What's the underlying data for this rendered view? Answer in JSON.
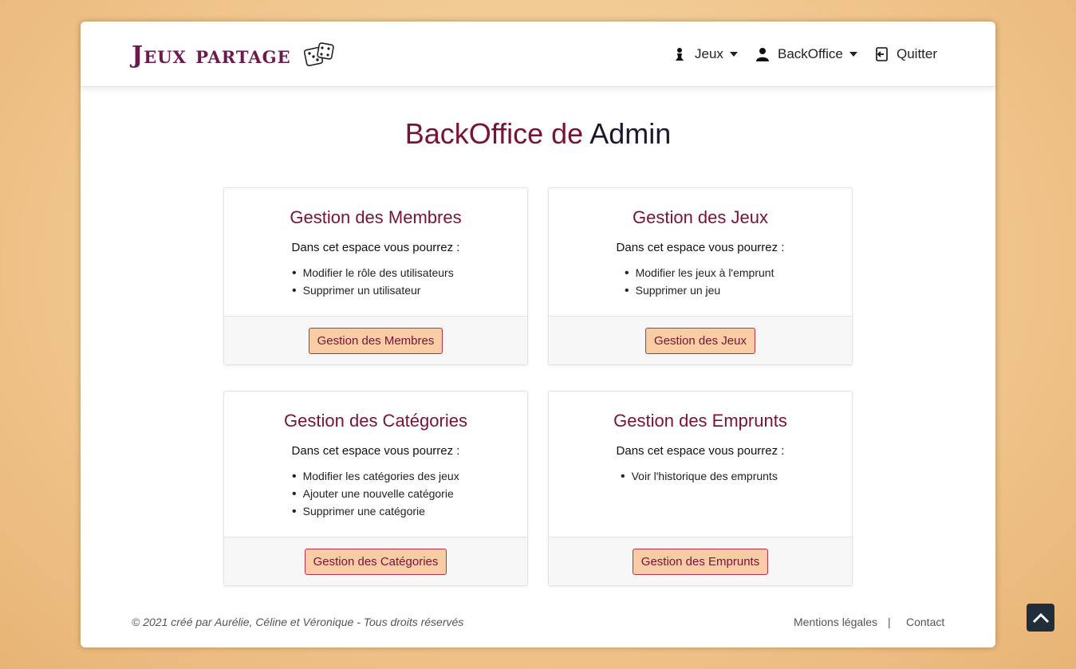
{
  "brand": {
    "name": "Jeux partage",
    "icon": "dice-icon"
  },
  "nav": {
    "jeux": {
      "label": "Jeux",
      "icon": "pawn-icon"
    },
    "backoffice": {
      "label": "BackOffice",
      "icon": "user-icon"
    },
    "quitter": {
      "label": "Quitter",
      "icon": "logout-icon"
    }
  },
  "page_title": {
    "prefix": "BackOffice de",
    "name": "Admin"
  },
  "cards": [
    {
      "title": "Gestion des Membres",
      "intro": "Dans cet espace vous pourrez :",
      "items": [
        "Modifier le rôle des utilisateurs",
        "Supprimer un utilisateur"
      ],
      "button": "Gestion des Membres"
    },
    {
      "title": "Gestion des Jeux",
      "intro": "Dans cet espace vous pourrez :",
      "items": [
        "Modifier les jeux à l'emprunt",
        "Supprimer un jeu"
      ],
      "button": "Gestion des Jeux"
    },
    {
      "title": "Gestion des Catégories",
      "intro": "Dans cet espace vous pourrez :",
      "items": [
        "Modifier les catégories des jeux",
        "Ajouter une nouvelle catégorie",
        "Supprimer une catégorie"
      ],
      "button": "Gestion des Catégories"
    },
    {
      "title": "Gestion des Emprunts",
      "intro": "Dans cet espace vous pourrez :",
      "items": [
        "Voir l'historique des emprunts"
      ],
      "button": "Gestion des Emprunts"
    }
  ],
  "footer": {
    "copyright": "© 2021 créé par Aurélie, Céline et Véronique - Tous droits réservés",
    "legal": "Mentions légales",
    "separator": "|",
    "contact": "Contact"
  },
  "colors": {
    "accent": "#7a1237",
    "button_bg": "#f8cda6",
    "brand": "#6a1a4c"
  }
}
